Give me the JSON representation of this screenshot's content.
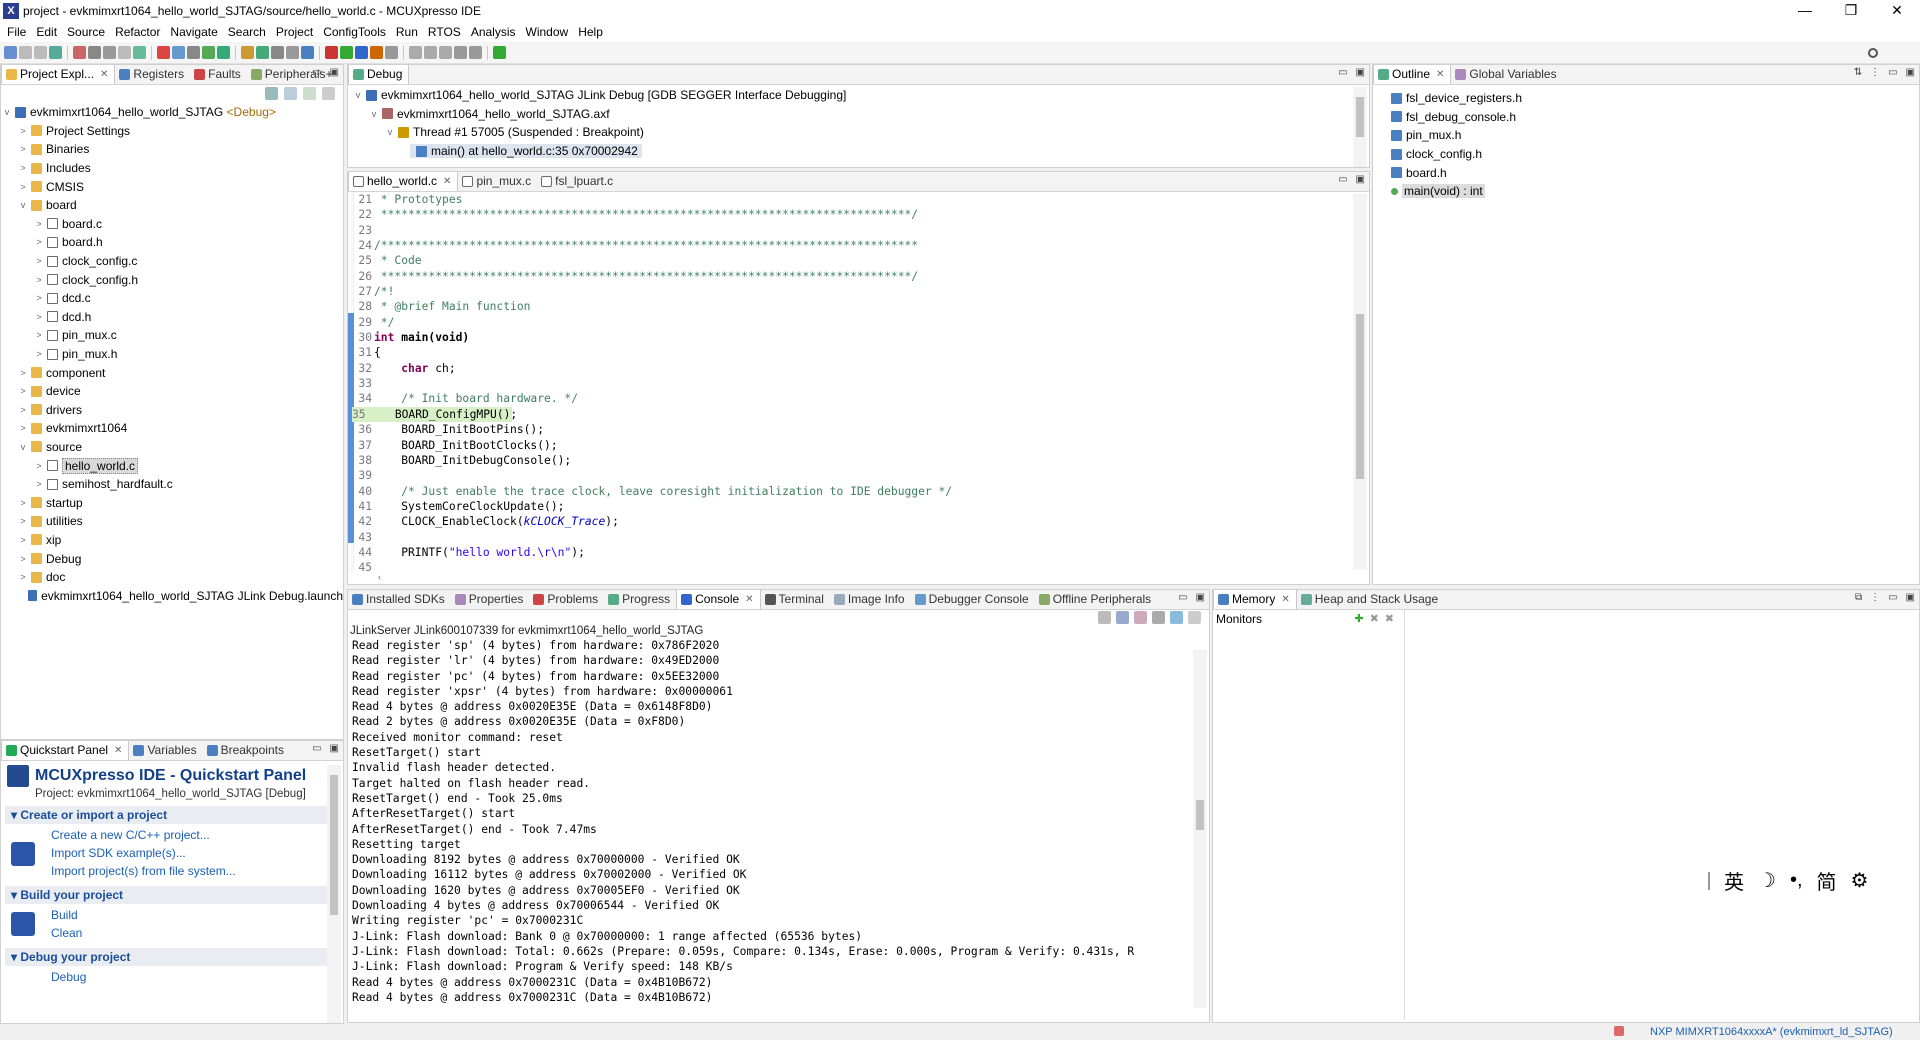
{
  "window": {
    "title": "project - evkmimxrt1064_hello_world_SJTAG/source/hello_world.c - MCUXpresso IDE",
    "app_icon": "X"
  },
  "menu": [
    "File",
    "Edit",
    "Source",
    "Refactor",
    "Navigate",
    "Search",
    "Project",
    "ConfigTools",
    "Run",
    "RTOS",
    "Analysis",
    "Window",
    "Help"
  ],
  "left_pane": {
    "tabs": [
      "Project Expl...",
      "Registers",
      "Faults",
      "Peripherals+"
    ],
    "project": "evkmimxrt1064_hello_world_SJTAG",
    "project_badge": "<Debug>",
    "tree": [
      {
        "label": "Project Settings",
        "depth": 1,
        "kind": "folder",
        "tw": ">"
      },
      {
        "label": "Binaries",
        "depth": 1,
        "kind": "folder",
        "tw": ">"
      },
      {
        "label": "Includes",
        "depth": 1,
        "kind": "folder",
        "tw": ">"
      },
      {
        "label": "CMSIS",
        "depth": 1,
        "kind": "folder",
        "tw": ">"
      },
      {
        "label": "board",
        "depth": 1,
        "kind": "folder",
        "tw": "v"
      },
      {
        "label": "board.c",
        "depth": 2,
        "kind": "cfile",
        "tw": ">"
      },
      {
        "label": "board.h",
        "depth": 2,
        "kind": "hfile",
        "tw": ">"
      },
      {
        "label": "clock_config.c",
        "depth": 2,
        "kind": "cfile",
        "tw": ">"
      },
      {
        "label": "clock_config.h",
        "depth": 2,
        "kind": "hfile",
        "tw": ">"
      },
      {
        "label": "dcd.c",
        "depth": 2,
        "kind": "cfile",
        "tw": ">"
      },
      {
        "label": "dcd.h",
        "depth": 2,
        "kind": "hfile",
        "tw": ">"
      },
      {
        "label": "pin_mux.c",
        "depth": 2,
        "kind": "cfile",
        "tw": ">"
      },
      {
        "label": "pin_mux.h",
        "depth": 2,
        "kind": "hfile",
        "tw": ">"
      },
      {
        "label": "component",
        "depth": 1,
        "kind": "folder",
        "tw": ">"
      },
      {
        "label": "device",
        "depth": 1,
        "kind": "folder",
        "tw": ">"
      },
      {
        "label": "drivers",
        "depth": 1,
        "kind": "folder",
        "tw": ">"
      },
      {
        "label": "evkmimxrt1064",
        "depth": 1,
        "kind": "folder",
        "tw": ">"
      },
      {
        "label": "source",
        "depth": 1,
        "kind": "folder",
        "tw": "v"
      },
      {
        "label": "hello_world.c",
        "depth": 2,
        "kind": "cfile",
        "tw": ">",
        "selected": true
      },
      {
        "label": "semihost_hardfault.c",
        "depth": 2,
        "kind": "cfile",
        "tw": ">"
      },
      {
        "label": "startup",
        "depth": 1,
        "kind": "folder",
        "tw": ">"
      },
      {
        "label": "utilities",
        "depth": 1,
        "kind": "folder",
        "tw": ">"
      },
      {
        "label": "xip",
        "depth": 1,
        "kind": "folder",
        "tw": ">"
      },
      {
        "label": "Debug",
        "depth": 1,
        "kind": "folder",
        "tw": ">"
      },
      {
        "label": "doc",
        "depth": 1,
        "kind": "folder",
        "tw": ">"
      },
      {
        "label": "evkmimxrt1064_hello_world_SJTAG JLink Debug.launch",
        "depth": 1,
        "kind": "launch",
        "tw": ""
      }
    ]
  },
  "debug_pane": {
    "tab": "Debug",
    "rows": [
      "evkmimxrt1064_hello_world_SJTAG JLink Debug [GDB SEGGER Interface Debugging]",
      "evkmimxrt1064_hello_world_SJTAG.axf",
      "Thread #1 57005 (Suspended : Breakpoint)",
      "main() at hello_world.c:35 0x70002942"
    ]
  },
  "editor": {
    "tabs": [
      "hello_world.c",
      "pin_mux.c",
      "fsl_lpuart.c"
    ],
    "lines": [
      {
        "n": "21",
        "t": " * Prototypes",
        "c": "cm"
      },
      {
        "n": "22",
        "t": " ******************************************************************************/",
        "c": "cm"
      },
      {
        "n": "23",
        "t": "",
        "c": ""
      },
      {
        "n": "24",
        "t": "/*******************************************************************************",
        "c": "cm"
      },
      {
        "n": "25",
        "t": " * Code",
        "c": "cm"
      },
      {
        "n": "26",
        "t": " ******************************************************************************/",
        "c": "cm"
      },
      {
        "n": "27",
        "t": "/*!",
        "c": "cm"
      },
      {
        "n": "28",
        "t": " * @brief Main function",
        "c": "cm"
      },
      {
        "n": "29",
        "t": " */",
        "c": "cm"
      },
      {
        "n": "30",
        "t": "int main(void)",
        "c": "kwline"
      },
      {
        "n": "31",
        "t": "{",
        "c": ""
      },
      {
        "n": "32",
        "t": "    char ch;",
        "c": "charline"
      },
      {
        "n": "33",
        "t": "",
        "c": ""
      },
      {
        "n": "34",
        "t": "    /* Init board hardware. */",
        "c": "cm"
      },
      {
        "n": "35",
        "t": "    BOARD_ConfigMPU();",
        "c": "hl"
      },
      {
        "n": "36",
        "t": "    BOARD_InitBootPins();",
        "c": ""
      },
      {
        "n": "37",
        "t": "    BOARD_InitBootClocks();",
        "c": ""
      },
      {
        "n": "38",
        "t": "    BOARD_InitDebugConsole();",
        "c": ""
      },
      {
        "n": "39",
        "t": "",
        "c": ""
      },
      {
        "n": "40",
        "t": "    /* Just enable the trace clock, leave coresight initialization to IDE debugger */",
        "c": "cm"
      },
      {
        "n": "41",
        "t": "    SystemCoreClockUpdate();",
        "c": ""
      },
      {
        "n": "42",
        "t": "    CLOCK_EnableClock(kCLOCK_Trace);",
        "c": "itline"
      },
      {
        "n": "43",
        "t": "",
        "c": ""
      },
      {
        "n": "44",
        "t": "    PRINTF(\"hello world.\\r\\n\");",
        "c": "strline"
      },
      {
        "n": "45",
        "t": "",
        "c": ""
      }
    ],
    "kw_int": "int",
    "main_sig": " main(void)",
    "kw_char": "char",
    "char_rest": " ch;",
    "clock_pre": "    CLOCK_EnableClock(",
    "clock_arg": "kCLOCK_Trace",
    "clock_post": ");",
    "printf_pre": "    PRINTF(",
    "printf_str": "\"hello world.\\r\\n\"",
    "printf_post": ");"
  },
  "outline": {
    "tabs": [
      "Outline",
      "Global Variables"
    ],
    "items": [
      "fsl_device_registers.h",
      "fsl_debug_console.h",
      "pin_mux.h",
      "clock_config.h",
      "board.h",
      "main(void) : int"
    ]
  },
  "console": {
    "tabs": [
      "Installed SDKs",
      "Properties",
      "Problems",
      "Progress",
      "Console",
      "Terminal",
      "Image Info",
      "Debugger Console",
      "Offline Peripherals"
    ],
    "header": "JLinkServer JLink600107339 for evkmimxrt1064_hello_world_SJTAG",
    "lines": [
      "Read register 'sp' (4 bytes) from hardware: 0x786F2020",
      "Read register 'lr' (4 bytes) from hardware: 0x49ED2000",
      "Read register 'pc' (4 bytes) from hardware: 0x5EE32000",
      "Read register 'xpsr' (4 bytes) from hardware: 0x00000061",
      "Read 4 bytes @ address 0x0020E35E (Data = 0x6148F8D0)",
      "Read 2 bytes @ address 0x0020E35E (Data = 0xF8D0)",
      "Received monitor command: reset",
      "ResetTarget() start",
      "Invalid flash header detected.",
      "Target halted on flash header read.",
      "ResetTarget() end - Took 25.0ms",
      "AfterResetTarget() start",
      "AfterResetTarget() end - Took 7.47ms",
      "Resetting target",
      "Downloading 8192 bytes @ address 0x70000000 - Verified OK",
      "Downloading 16112 bytes @ address 0x70002000 - Verified OK",
      "Downloading 1620 bytes @ address 0x70005EF0 - Verified OK",
      "Downloading 4 bytes @ address 0x70006544 - Verified OK",
      "Writing register 'pc' = 0x7000231C",
      "J-Link: Flash download: Bank 0 @ 0x70000000: 1 range affected (65536 bytes)",
      "J-Link: Flash download: Total: 0.662s (Prepare: 0.059s, Compare: 0.134s, Erase: 0.000s, Program & Verify: 0.431s, R",
      "J-Link: Flash download: Program & Verify speed: 148 KB/s",
      "Read 4 bytes @ address 0x7000231C (Data = 0x4B10B672)",
      "Read 4 bytes @ address 0x7000231C (Data = 0x4B10B672)"
    ]
  },
  "memory": {
    "tabs": [
      "Memory",
      "Heap and Stack Usage"
    ],
    "monitors_label": "Monitors"
  },
  "quickstart": {
    "tabs": [
      "Quickstart Panel",
      "Variables",
      "Breakpoints"
    ],
    "title": "MCUXpresso IDE - Quickstart Panel",
    "project_line": "Project: evkmimxrt1064_hello_world_SJTAG [Debug]",
    "sec1": "Create or import a project",
    "links1": [
      "Create a new C/C++ project...",
      "Import SDK example(s)...",
      "Import project(s) from file system..."
    ],
    "sec2": "Build your project",
    "links2": [
      "Build",
      "Clean"
    ],
    "sec3": "Debug your project",
    "links3": [
      "Debug"
    ]
  },
  "status": {
    "right": "NXP MIMXRT1064xxxxA* (evkmimxrt_ld_SJTAG)"
  },
  "ime": [
    "英",
    "☽",
    "•,",
    "简",
    "⚙"
  ],
  "colors": {
    "accent": "#1a5fb4",
    "keyword": "#7f0055",
    "comment": "#3f7f5f",
    "string": "#2a00ff",
    "current_line": "#d8f0c8"
  }
}
